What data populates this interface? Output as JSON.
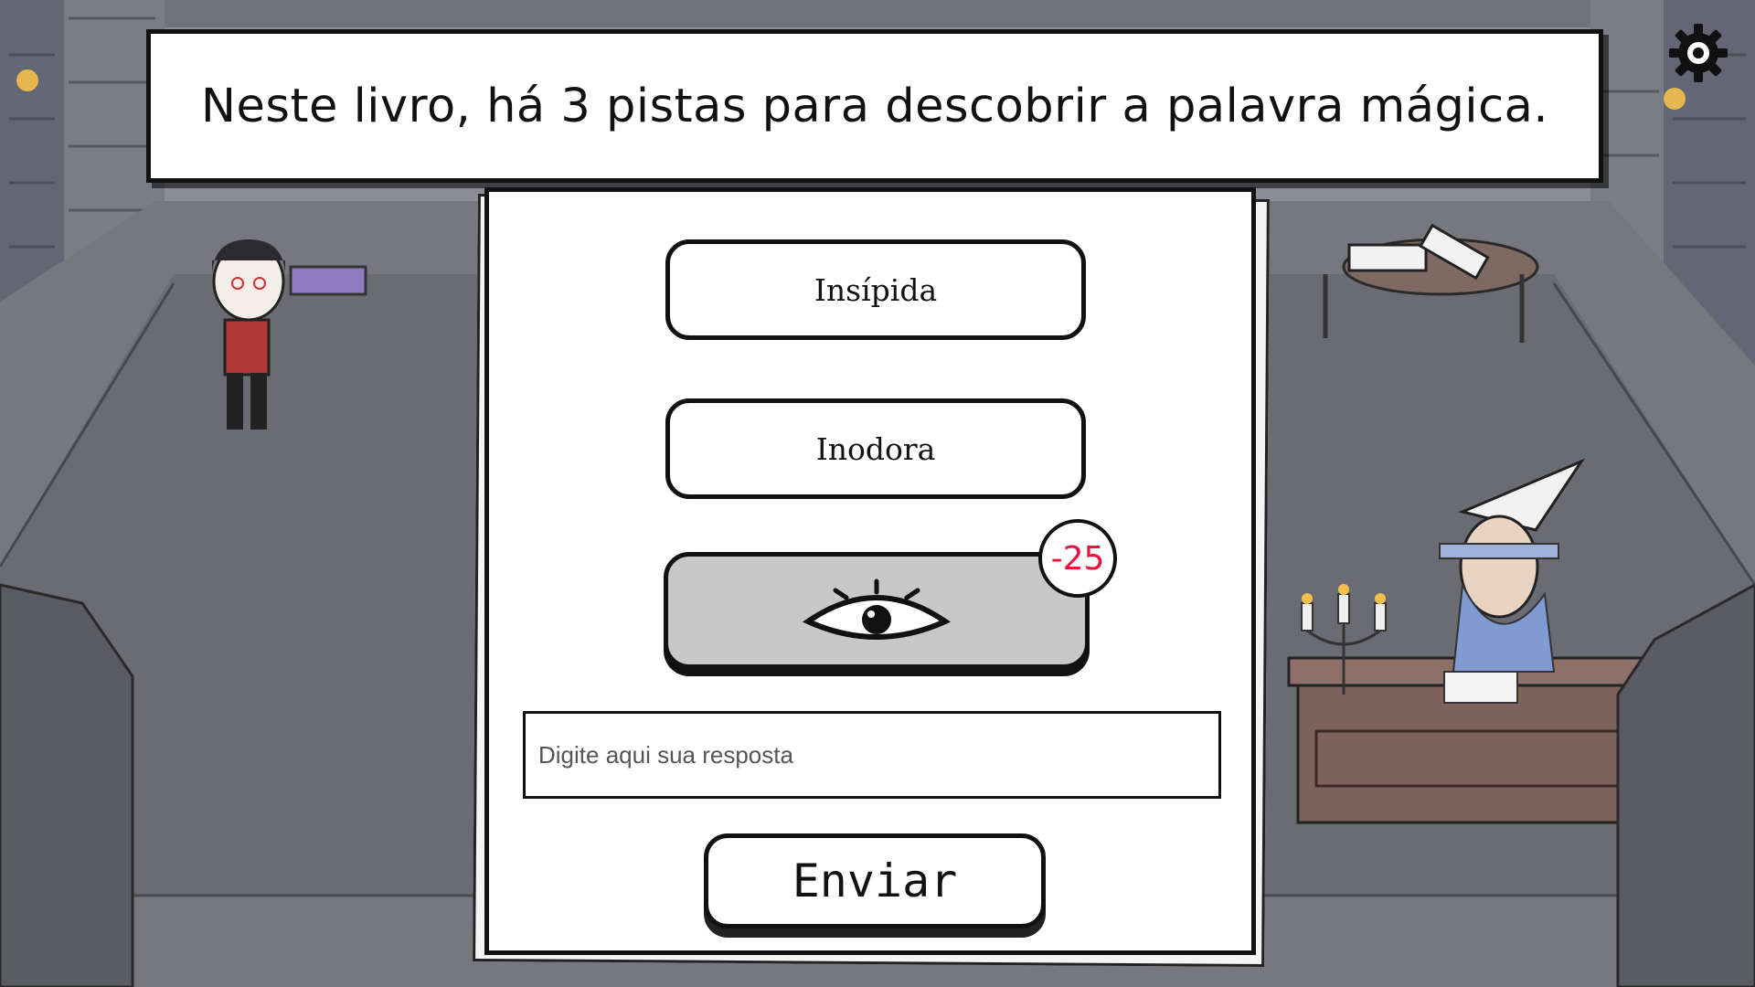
{
  "banner": {
    "text": "Neste livro, há 3 pistas para descobrir a palavra mágica."
  },
  "settings": {
    "icon": "gear-icon"
  },
  "clues": [
    {
      "label": "Insípida"
    },
    {
      "label": "Inodora"
    }
  ],
  "hint": {
    "icon": "eye-icon",
    "cost": "-25"
  },
  "answer": {
    "placeholder": "Digite aqui sua resposta",
    "value": ""
  },
  "submit": {
    "label": "Enviar"
  },
  "colors": {
    "cost_red": "#e8143c",
    "hint_bg": "#c8c8c8"
  }
}
